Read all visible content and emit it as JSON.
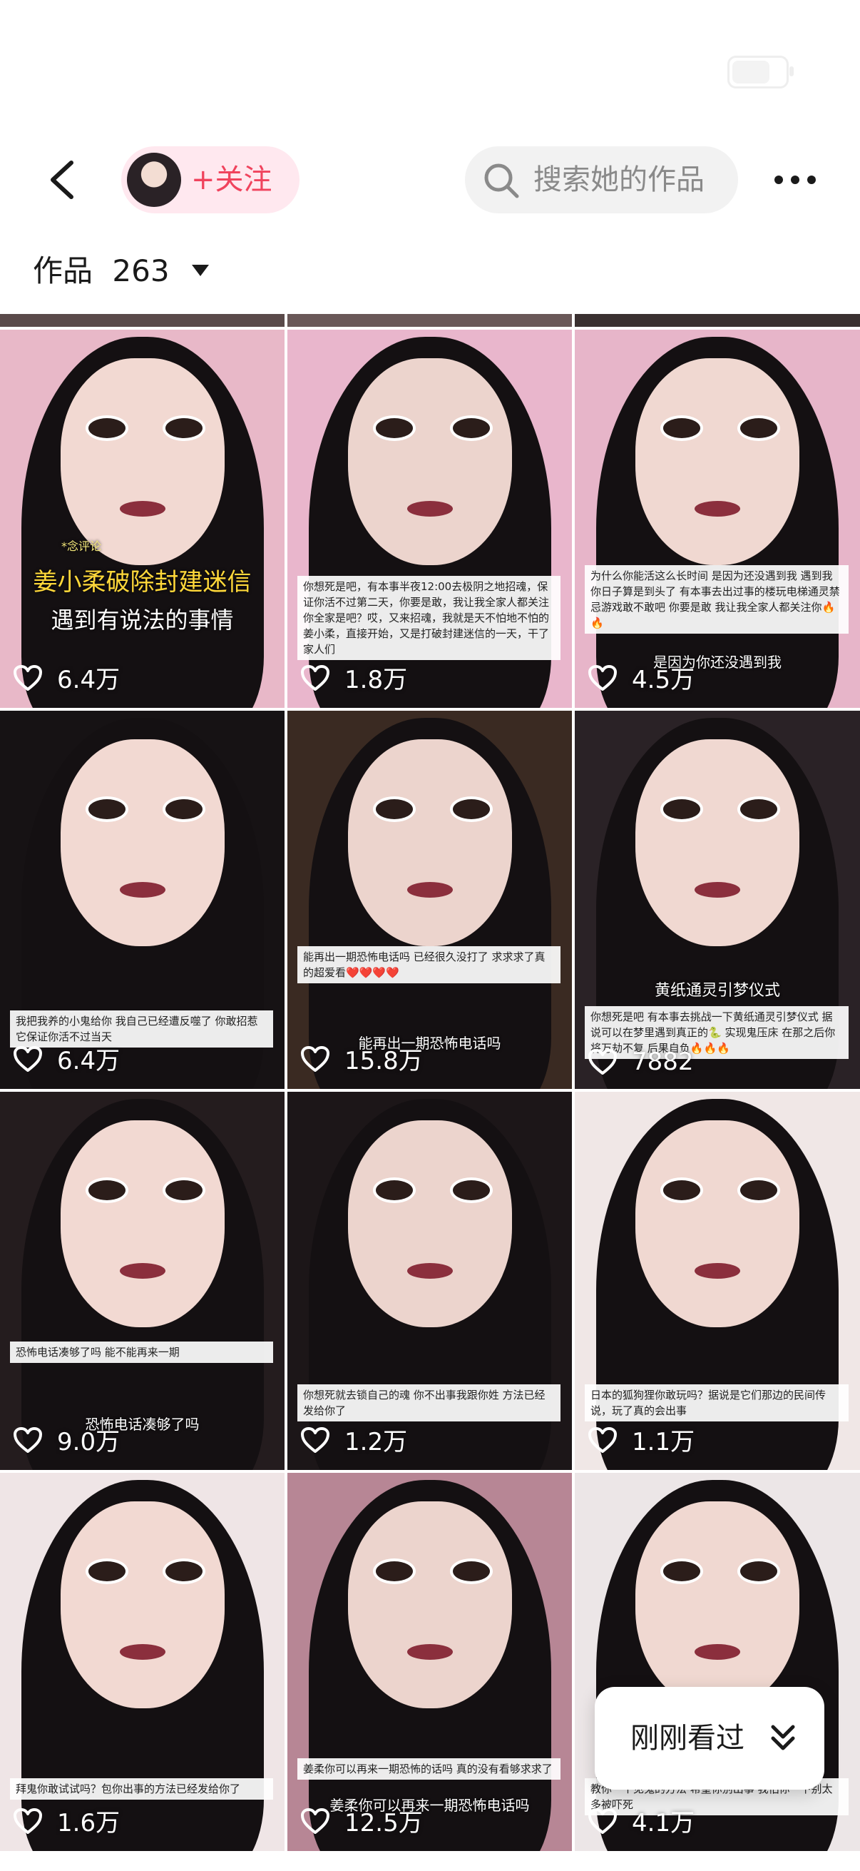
{
  "header": {
    "follow_label": "+关注",
    "search_placeholder": "搜索她的作品"
  },
  "works": {
    "label": "作品",
    "count": "263"
  },
  "grid": [
    {
      "likes": "6.4万",
      "caption_small": "*念评论",
      "caption_title": "姜小柔破除封建迷信",
      "caption_sub": "遇到有说法的事情",
      "caption": ""
    },
    {
      "likes": "1.8万",
      "caption": "你想死是吧，有本事半夜12:00去极阴之地招魂，保证你活不过第二天，你要是敢，我让我全家人都关注你全家是吧？哎，又来招魂，我就是天不怕地不怕的姜小柔，直接开始，又是打破封建迷信的一天，干了家人们"
    },
    {
      "likes": "4.5万",
      "caption": "为什么你能活这么长时间 是因为还没遇到我 遇到我你日子算是到头了 有本事去出过事的楼玩电梯通灵禁忌游戏敢不敢吧 你要是敢 我让我全家人都关注你🔥🔥",
      "caption_sub": "是因为你还没遇到我"
    },
    {
      "likes": "6.4万",
      "caption": "我把我养的小鬼给你 我自己已经遭反噬了 你敢招惹它保证你活不过当天"
    },
    {
      "likes": "15.8万",
      "caption": "能再出一期恐怖电话吗 已经很久没打了 求求求了真的超爱看❤️❤️❤️❤️",
      "caption_sub": "能再出一期恐怖电话吗"
    },
    {
      "likes": "7882",
      "caption_title": "黄纸通灵引梦仪式",
      "caption": "你想死是吧 有本事去挑战一下黄纸通灵引梦仪式 据说可以在梦里遇到真正的🐍 实现鬼压床 在那之后你将万劫不复 后果自负🔥🔥🔥"
    },
    {
      "likes": "9.0万",
      "caption": "恐怖电话凑够了吗 能不能再来一期",
      "caption_sub": "恐怖电话凑够了吗"
    },
    {
      "likes": "1.2万",
      "caption": "你想死就去锁自己的魂 你不出事我跟你姓 方法已经发给你了"
    },
    {
      "likes": "1.1万",
      "caption": "日本的狐狗狸你敢玩吗？据说是它们那边的民间传说，玩了真的会出事"
    },
    {
      "likes": "1.6万",
      "caption": "拜鬼你敢试试吗？包你出事的方法已经发给你了"
    },
    {
      "likes": "12.5万",
      "caption_sub": "姜柔你可以再来一期恐怖电话吗",
      "caption": "姜柔你可以再来一期恐怖的话吗 真的没有看够求求了"
    },
    {
      "likes": "4.1万",
      "caption": "教你一个见鬼的方法 希望你别出事 我怕你一下别太多被吓死"
    }
  ],
  "recent_viewed": {
    "label": "刚刚看过"
  },
  "colors": {
    "accent": "#f0435d",
    "pill_bg": "#ffe8ef"
  }
}
